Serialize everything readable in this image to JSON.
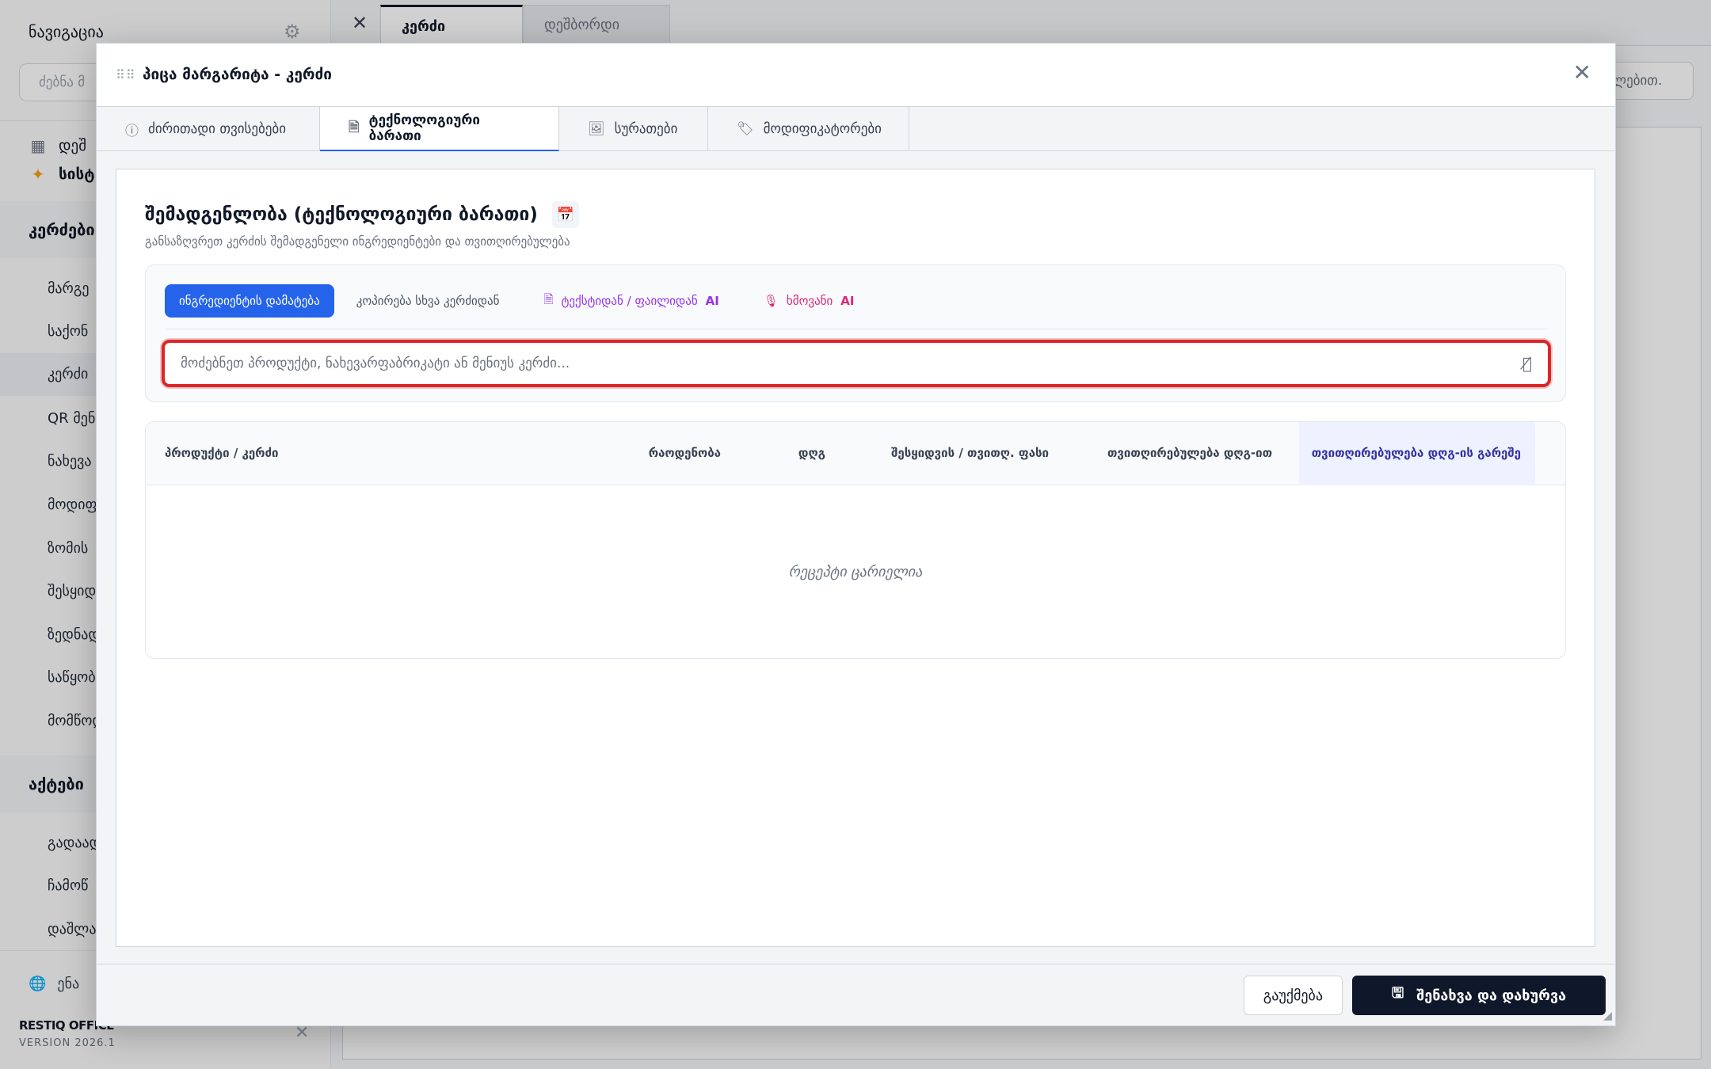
{
  "sidebar": {
    "title": "ნავიგაცია",
    "search_placeholder": "ძებნა მ",
    "top_items": [
      {
        "label": "დეშ"
      },
      {
        "label": "სისტ"
      }
    ],
    "sections": [
      {
        "label": "კერძები",
        "items": [
          "მარგე",
          "საქონ",
          "კერძი",
          "QR მენ",
          "ნახევა",
          "მოდიფ",
          "ზომის",
          "შესყიდ",
          "ზედნად",
          "საწყობ",
          "მომწოდ"
        ]
      },
      {
        "label": "აქტები",
        "items": [
          "გადაად",
          "ჩამოწ",
          "დაშლა"
        ]
      }
    ],
    "language_label": "ენა",
    "brand": "RESTIQ OFFICE",
    "version": "VERSION 2026.1"
  },
  "topbar": {
    "tabs": [
      {
        "label": "კერძი",
        "active": true
      },
      {
        "label": "დეშბორდი",
        "active": false
      }
    ],
    "search_placeholder": "ლებით."
  },
  "modal": {
    "title": "პიცა მარგარიტა - კერძი",
    "tabs": [
      {
        "label": "ძირითადი თვისებები",
        "icon": "info-icon"
      },
      {
        "label": "ტექნოლოგიური ბარათი",
        "icon": "document-icon",
        "active": true
      },
      {
        "label": "სურათები",
        "icon": "image-icon"
      },
      {
        "label": "მოდიფიკატორები",
        "icon": "tag-icon"
      }
    ],
    "section": {
      "title": "შემადგენლობა (ტექნოლოგიური ბარათი)",
      "subtitle": "განსაზღვრეთ კერძის შემადგენელი ინგრედიენტები და თვითღირებულება"
    },
    "add_options": {
      "primary": "ინგრედიენტის დამატება",
      "copy": "კოპირება სხვა კერძიდან",
      "text_ai_prefix": "ტექსტიდან / ფაილიდან",
      "voice_ai_prefix": "ხმოვანი",
      "ai": "AI"
    },
    "search": {
      "placeholder": "მოძებნეთ პროდუქტი, ნახევარფაბრიკატი ან მენიუს კერძი..."
    },
    "table": {
      "headers": {
        "product": "პროდუქტი / კერძი",
        "quantity": "რაოდენობა",
        "vat": "დღგ",
        "price": "შესყიდვის / თვითღ. ფასი",
        "cost_with_vat": "თვითღირებულება დღგ-ით",
        "cost_without_vat": "თვითღირებულება დღგ-ის გარეშე"
      },
      "empty_text": "რეცეპტი ცარიელია"
    },
    "footer": {
      "cancel": "გაუქმება",
      "save": "შენახვა და დახურვა"
    }
  },
  "colors": {
    "primary": "#2563eb",
    "dark": "#0f172a",
    "highlight_border": "#dc2626",
    "ai_purple": "#9333ea",
    "ai_pink": "#db2777"
  }
}
